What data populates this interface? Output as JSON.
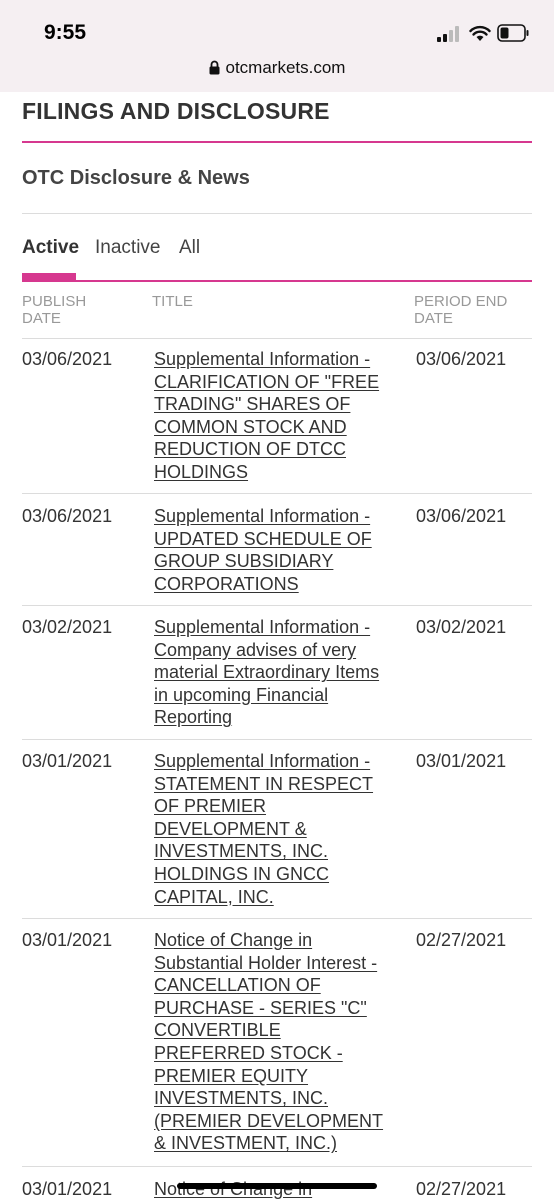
{
  "status": {
    "time": "9:55",
    "url": "otcmarkets.com"
  },
  "section_title": "FILINGS AND DISCLOSURE",
  "subsection_title": "OTC Disclosure & News",
  "tabs": [
    {
      "label": "Active"
    },
    {
      "label": "Inactive"
    },
    {
      "label": "All"
    }
  ],
  "columns": {
    "publish_line1": "PUBLISH",
    "publish_line2": "DATE",
    "title": "TITLE",
    "period_line1": "PERIOD END",
    "period_line2": "DATE"
  },
  "rows": [
    {
      "publish": "03/06/2021",
      "title": "Supplemental Information - CLARIFICATION OF \"FREE TRADING\" SHARES OF COMMON STOCK AND REDUCTION OF DTCC HOLDINGS",
      "period": "03/06/2021"
    },
    {
      "publish": "03/06/2021",
      "title": "Supplemental Information - UPDATED SCHEDULE OF GROUP SUBSIDIARY CORPORATIONS",
      "period": "03/06/2021"
    },
    {
      "publish": "03/02/2021",
      "title": "Supplemental Information - Company advises of very material Extraordinary Items in upcoming Financial Reporting",
      "period": "03/02/2021"
    },
    {
      "publish": "03/01/2021",
      "title": "Supplemental Information - STATEMENT IN RESPECT OF PREMIER DEVELOPMENT & INVESTMENTS, INC. HOLDINGS IN GNCC CAPITAL, INC.",
      "period": "03/01/2021"
    },
    {
      "publish": "03/01/2021",
      "title": "Notice of Change in Substantial Holder Interest - CANCELLATION OF PURCHASE - SERIES \"C\" CONVERTIBLE PREFERRED STOCK - PREMIER EQUITY INVESTMENTS, INC. (PREMIER DEVELOPMENT & INVESTMENT, INC.)",
      "period": "02/27/2021"
    },
    {
      "publish": "03/01/2021",
      "title": "Notice of Change in",
      "period": "02/27/2021"
    }
  ]
}
